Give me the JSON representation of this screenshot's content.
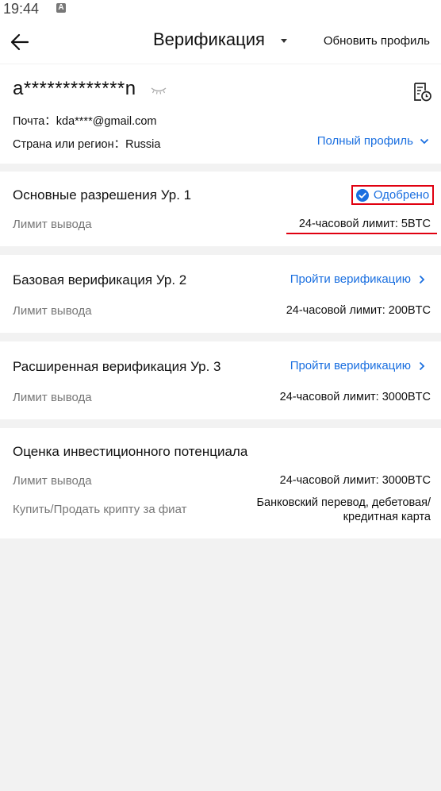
{
  "status_bar": {
    "time": "19:44",
    "indicator": "A"
  },
  "app_bar": {
    "back_icon": "arrow-left-icon",
    "title": "Верификация",
    "action": "Обновить профиль"
  },
  "profile": {
    "name": "a*************n",
    "email_line": "Почта：kda****@gmail.com",
    "country_line": "Страна или регион：Russia",
    "full_profile_link": "Полный профиль"
  },
  "levels": [
    {
      "title": "Основные разрешения Ур. 1",
      "status": "Одобрено",
      "label": "Лимит вывода",
      "value": "24-часовой лимит: 5BTC"
    },
    {
      "title": "Базовая верификация Ур. 2",
      "action": "Пройти верификацию",
      "label": "Лимит вывода",
      "value": "24-часовой лимит: 200BTC"
    },
    {
      "title": "Расширенная верификация Ур. 3",
      "action": "Пройти верификацию",
      "label": "Лимит вывода",
      "value": "24-часовой лимит: 3000BTC"
    }
  ],
  "investment": {
    "title": "Оценка инвестиционного потенциала",
    "label1": "Лимит вывода",
    "value1": "24-часовой лимит: 3000BTC",
    "label2": "Купить/Продать крипту за фиат",
    "value2_line1": "Банковский перевод, дебетовая/",
    "value2_line2": "кредитная карта"
  },
  "colors": {
    "accent": "#1a6fe0",
    "highlight": "#e00010",
    "background": "#f2f2f2"
  }
}
